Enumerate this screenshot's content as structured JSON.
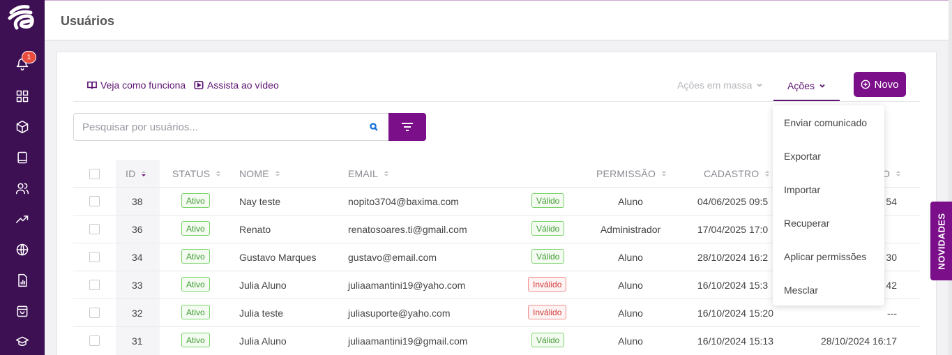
{
  "page": {
    "title": "Usuários"
  },
  "links": {
    "how_it_works": "Veja como funciona",
    "watch_video": "Assista ao vídeo"
  },
  "toolbar": {
    "bulk_actions": "Ações em massa",
    "actions": "Ações",
    "new": "Novo"
  },
  "search": {
    "placeholder": "Pesquisar por usuários..."
  },
  "notifications": {
    "count": "1"
  },
  "columns": {
    "id": "ID",
    "status": "STATUS",
    "name": "NOME",
    "email": "EMAIL",
    "permission": "PERMISSÃO",
    "created": "CADASTRO",
    "last_col_fragment": "O"
  },
  "rows": [
    {
      "id": "38",
      "status": "Ativo",
      "name": "Nay teste",
      "email": "nopito3704@baxima.com",
      "validity": "Válido",
      "valid": true,
      "permission": "Aluno",
      "created": "04/06/2025 09:5",
      "last": "54"
    },
    {
      "id": "36",
      "status": "Ativo",
      "name": "Renato",
      "email": "renatosoares.ti@gmail.com",
      "validity": "Válido",
      "valid": true,
      "permission": "Administrador",
      "created": "17/04/2025 17:0",
      "last": ""
    },
    {
      "id": "34",
      "status": "Ativo",
      "name": "Gustavo Marques",
      "email": "gustavo@email.com",
      "validity": "Válido",
      "valid": true,
      "permission": "Aluno",
      "created": "28/10/2024 16:2",
      "last": "30"
    },
    {
      "id": "33",
      "status": "Ativo",
      "name": "Julia Aluno",
      "email": "juliaamantini19@yaho.com",
      "validity": "Inválido",
      "valid": false,
      "permission": "Aluno",
      "created": "16/10/2024 15:3",
      "last": "42"
    },
    {
      "id": "32",
      "status": "Ativo",
      "name": "Julia teste",
      "email": "juliasuporte@yaho.com",
      "validity": "Inválido",
      "valid": false,
      "permission": "Aluno",
      "created": "16/10/2024 15:20",
      "last": "---"
    },
    {
      "id": "31",
      "status": "Ativo",
      "name": "Julia Aluno",
      "email": "juliaamantini19@gmail.com",
      "validity": "Válido",
      "valid": true,
      "permission": "Aluno",
      "created": "16/10/2024 15:13",
      "last": "28/10/2024 16:17"
    }
  ],
  "dropdown": [
    "Enviar comunicado",
    "Exportar",
    "Importar",
    "Recuperar",
    "Aplicar permissões",
    "Mesclar"
  ],
  "news_tab": "NOVIDADES",
  "colors": {
    "sidebar": "#3d0f53",
    "primary": "#7a0f89",
    "valid": "#3f9a30",
    "invalid": "#d23b3b"
  }
}
